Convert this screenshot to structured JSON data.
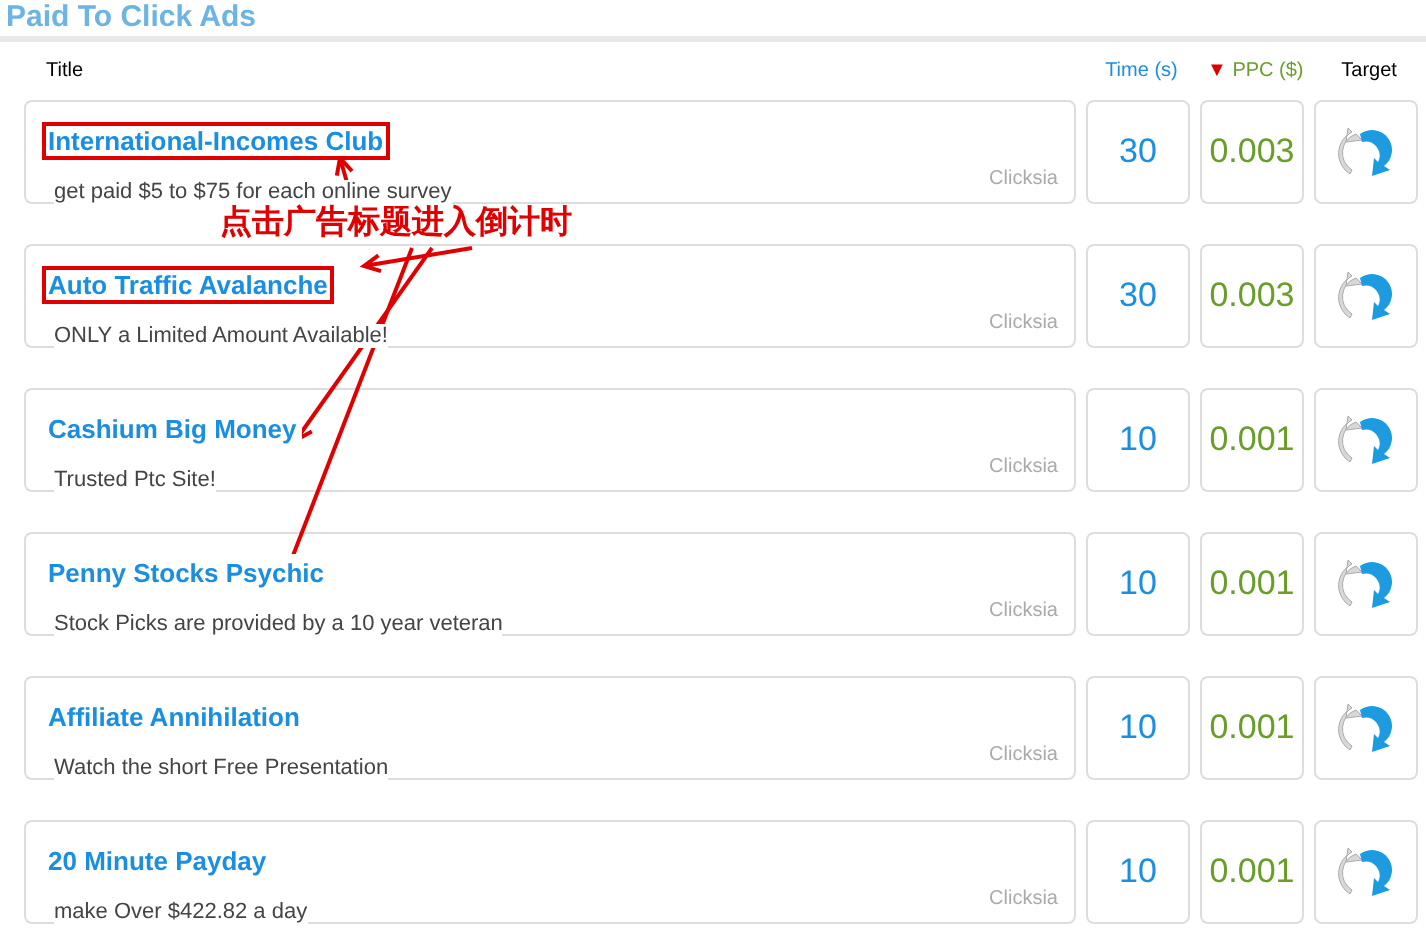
{
  "heading": "Paid To Click Ads",
  "columns": {
    "title": "Title",
    "time": "Time (s)",
    "ppc": "PPC ($)",
    "target": "Target"
  },
  "sort": {
    "mark": "▼"
  },
  "ads": [
    {
      "title": "International-Incomes Club",
      "description": "get paid $5 to $75 for each online survey",
      "source": "Clicksia",
      "time": "30",
      "ppc": "0.003",
      "highlighted": true
    },
    {
      "title": "Auto Traffic Avalanche",
      "description": "ONLY a Limited Amount Available!",
      "source": "Clicksia",
      "time": "30",
      "ppc": "0.003",
      "highlighted": true
    },
    {
      "title": "Cashium Big Money",
      "description": "Trusted Ptc Site!",
      "source": "Clicksia",
      "time": "10",
      "ppc": "0.001",
      "highlighted": false
    },
    {
      "title": "Penny Stocks Psychic",
      "description": "Stock Picks are provided by a 10 year veteran",
      "source": "Clicksia",
      "time": "10",
      "ppc": "0.001",
      "highlighted": false
    },
    {
      "title": "Affiliate Annihilation",
      "description": "Watch the short Free Presentation",
      "source": "Clicksia",
      "time": "10",
      "ppc": "0.001",
      "highlighted": false
    },
    {
      "title": "20 Minute Payday",
      "description": "make Over $422.82 a day",
      "source": "Clicksia",
      "time": "10",
      "ppc": "0.001",
      "highlighted": false
    }
  ],
  "annotation": {
    "text": "点击广告标题进入倒计时"
  }
}
